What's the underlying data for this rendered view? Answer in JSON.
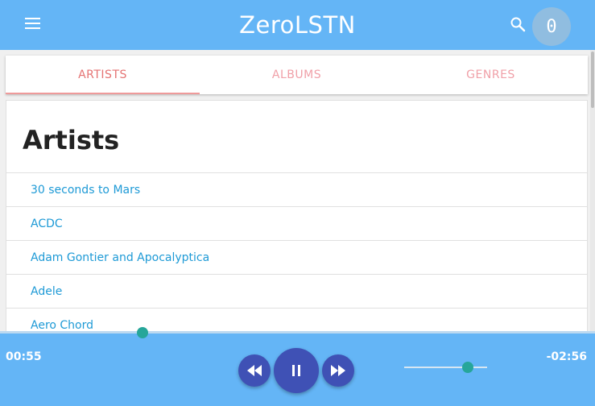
{
  "header": {
    "title": "ZeroLSTN",
    "menu_icon": "menu-icon",
    "search_icon": "search-icon",
    "badge_count": "0"
  },
  "tabs": [
    {
      "label": "ARTISTS",
      "active": true
    },
    {
      "label": "ALBUMS",
      "active": false
    },
    {
      "label": "GENRES",
      "active": false
    }
  ],
  "main": {
    "title": "Artists",
    "artists": [
      "30 seconds to Mars",
      "ACDC",
      "Adam Gontier and Apocalyptica",
      "Adele",
      "Aero Chord"
    ]
  },
  "player": {
    "elapsed": "00:55",
    "remaining": "-02:56",
    "progress_fraction": 0.24,
    "volume_fraction": 0.77,
    "rewind_icon": "rewind-icon",
    "pause_icon": "pause-icon",
    "forward_icon": "fast-forward-icon"
  },
  "colors": {
    "primary": "#64b5f6",
    "accent": "#e57373",
    "link": "#1e9ad6",
    "button": "#3f51b5",
    "knob": "#26a69a"
  }
}
